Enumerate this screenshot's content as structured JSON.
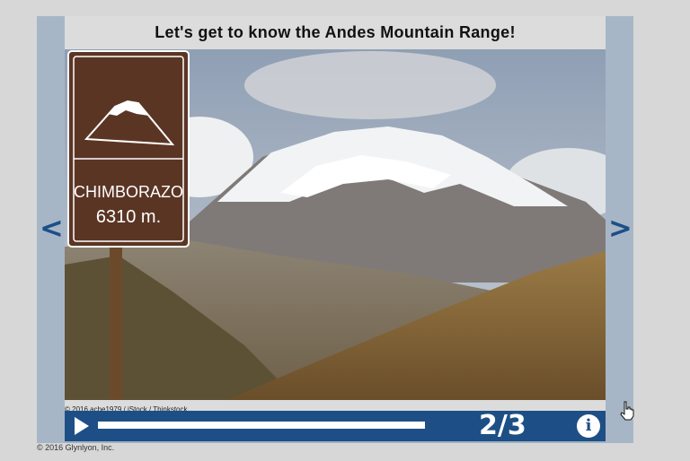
{
  "slide": {
    "title": "Let's get to know the Andes Mountain Range!",
    "photo_credit": "© 2016 ache1979 / iStock / Thinkstock",
    "sign_line1": "CHIMBORAZO",
    "sign_line2": "6310 m.",
    "prev_label": "<",
    "next_label": ">"
  },
  "player": {
    "counter": "2/3",
    "progress_fraction": 1.0,
    "info_icon": "i"
  },
  "footer": {
    "copyright": "© 2016 Glynlyon, Inc."
  },
  "colors": {
    "accent": "#1d4f86",
    "side_panel": "#a7b6c6",
    "title_bg": "#dcdcdc",
    "page_bg": "#d7d7d7"
  },
  "icons": [
    "play-icon",
    "info-icon",
    "chevron-left-icon",
    "chevron-right-icon",
    "hand-cursor-icon"
  ]
}
